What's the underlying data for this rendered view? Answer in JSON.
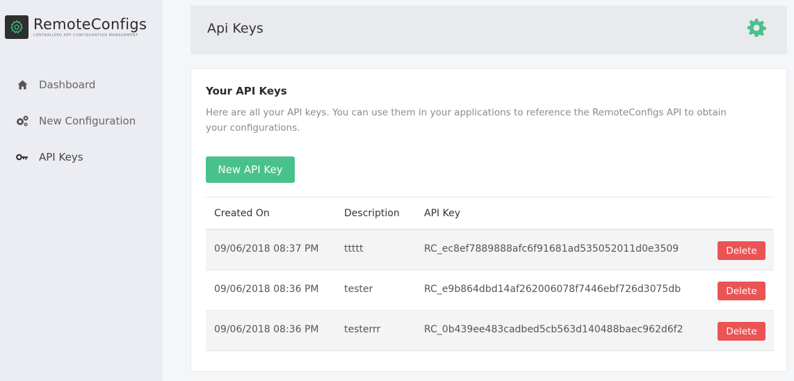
{
  "brand": {
    "name": "RemoteConfigs",
    "tagline": "Centralized App Configuration Management"
  },
  "sidebar": {
    "items": [
      {
        "label": "Dashboard",
        "icon": "home-icon"
      },
      {
        "label": "New Configuration",
        "icon": "gears-icon"
      },
      {
        "label": "API Keys",
        "icon": "key-icon"
      }
    ]
  },
  "header": {
    "title": "Api Keys",
    "settings_icon": "gear-icon"
  },
  "card": {
    "title": "Your API Keys",
    "description": "Here are all your API keys. You can use them in your applications to reference the RemoteConfigs API to obtain your configurations.",
    "new_button": "New API Key"
  },
  "table": {
    "headers": [
      "Created On",
      "Description",
      "API Key"
    ],
    "rows": [
      {
        "created": "09/06/2018 08:37 PM",
        "description": "ttttt",
        "key": "RC_ec8ef7889888afc6f91681ad535052011d0e3509",
        "action": "Delete"
      },
      {
        "created": "09/06/2018 08:36 PM",
        "description": "tester",
        "key": "RC_e9b864dbd14af262006078f7446ebf726d3075db",
        "action": "Delete"
      },
      {
        "created": "09/06/2018 08:36 PM",
        "description": "testerrr",
        "key": "RC_0b439ee483cadbed5cb563d140488baec962d6f2",
        "action": "Delete"
      }
    ]
  },
  "colors": {
    "accent": "#49c18c",
    "danger": "#ea5455",
    "sidebar_bg": "#ecedf2"
  }
}
